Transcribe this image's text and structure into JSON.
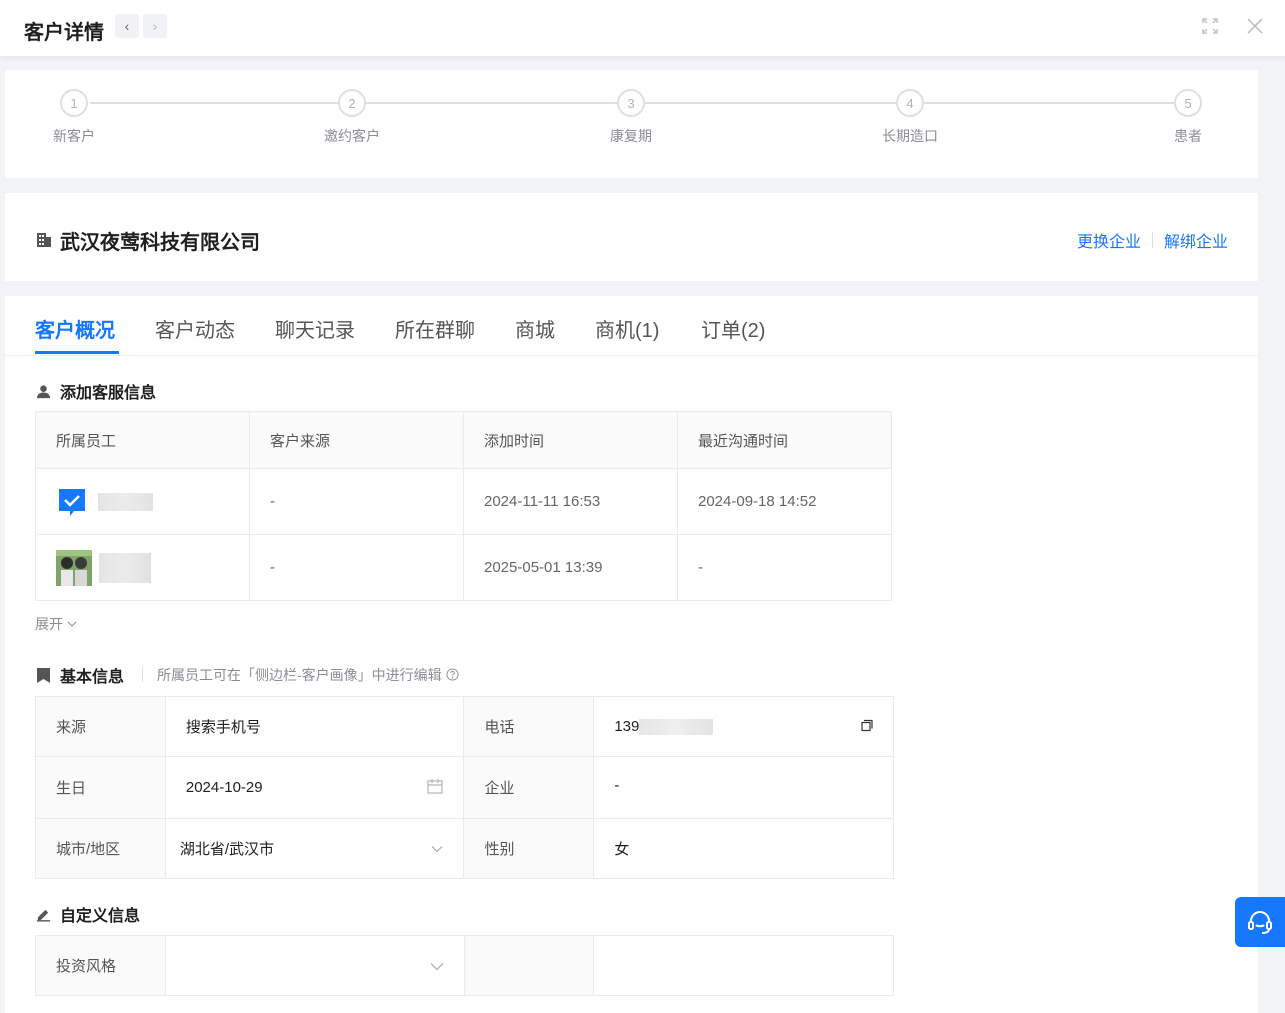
{
  "header": {
    "title": "客户详情",
    "prev_label": "‹",
    "next_label": "›"
  },
  "steps": [
    {
      "num": "1",
      "label": "新客户"
    },
    {
      "num": "2",
      "label": "邀约客户"
    },
    {
      "num": "3",
      "label": "康复期"
    },
    {
      "num": "4",
      "label": "长期造口"
    },
    {
      "num": "5",
      "label": "患者"
    }
  ],
  "company": {
    "name": "武汉夜莺科技有限公司",
    "change_label": "更换企业",
    "unbind_label": "解绑企业"
  },
  "tabs": [
    "客户概况",
    "客户动态",
    "聊天记录",
    "所在群聊",
    "商城",
    "商机(1)",
    "订单(2)"
  ],
  "service_section": {
    "title": "添加客服信息",
    "columns": [
      "所属员工",
      "客户来源",
      "添加时间",
      "最近沟通时间"
    ],
    "rows": [
      {
        "source": "-",
        "added": "2024-11-11 16:53",
        "last_contact": "2024-09-18 14:52"
      },
      {
        "source": "-",
        "added": "2025-05-01 13:39",
        "last_contact": "-"
      }
    ],
    "expand_label": "展开"
  },
  "basic_section": {
    "title": "基本信息",
    "note": "所属员工可在「侧边栏-客户画像」中进行编辑",
    "source_label": "来源",
    "source_value": "搜索手机号",
    "phone_label": "电话",
    "phone_value": "139",
    "birthday_label": "生日",
    "birthday_value": "2024-10-29",
    "company_label": "企业",
    "company_value": "-",
    "city_label": "城市/地区",
    "city_value": "湖北省/武汉市",
    "gender_label": "性别",
    "gender_value": "女"
  },
  "custom_section": {
    "title": "自定义信息",
    "invest_label": "投资风格",
    "invest_value": ""
  },
  "colors": {
    "accent": "#1677ff",
    "border": "#e9ebee",
    "muted": "#8a8e94"
  }
}
